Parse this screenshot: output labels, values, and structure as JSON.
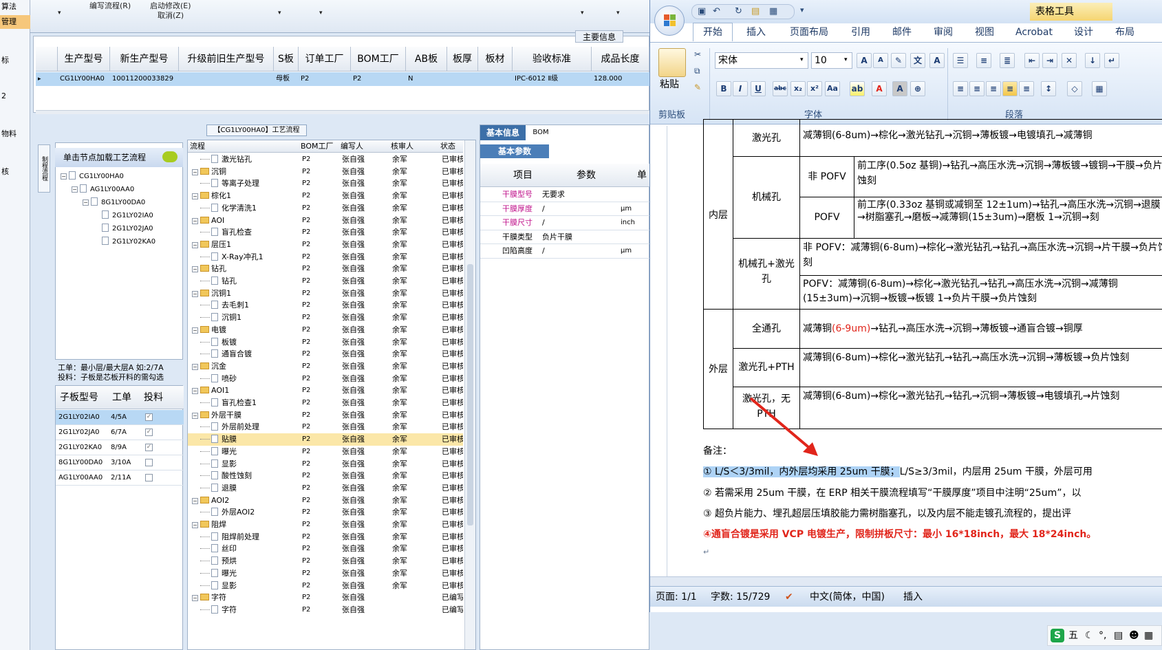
{
  "left_strip": [
    "算法",
    "管理",
    "标",
    "2",
    "物料",
    "核"
  ],
  "top_menu": {
    "item1": "编写流程(R)",
    "item2": "启动修改(E)",
    "item3": "取消(Z)"
  },
  "main_info_label": "主要信息",
  "product_grid": {
    "headers": [
      "生产型号",
      "新生产型号",
      "升级前旧生产型号",
      "S板",
      "订单工厂",
      "BOM工厂",
      "AB板",
      "板厚",
      "板材",
      "验收标准",
      "成品长度"
    ],
    "row": [
      "CG1LY00HA0",
      "10011200033829",
      "",
      "母板",
      "P2",
      "P2",
      "N",
      "",
      "",
      "IPC-6012 Ⅱ级",
      "128.000"
    ]
  },
  "flow_title": "【CG1LY00HA0】工艺流程",
  "side_tab": "制程流程",
  "load_hint": "单击节点加载工艺流程",
  "tree": [
    "CG1LY00HA0",
    "AG1LY00AA0",
    "8G1LY00DA0",
    "2G1LY02IA0",
    "2G1LY02JA0",
    "2G1LY02KA0"
  ],
  "notes": {
    "line1": "工单：最小层/最大层A 如:2/7A",
    "line2": "投料：子板是芯板开料的需勾选"
  },
  "sub_board": {
    "headers": [
      "子板型号",
      "工单",
      "投料"
    ],
    "rows": [
      {
        "model": "2G1LY02IA0",
        "order": "4/5A",
        "checked": true
      },
      {
        "model": "2G1LY02JA0",
        "order": "6/7A",
        "checked": true
      },
      {
        "model": "2G1LY02KA0",
        "order": "8/9A",
        "checked": true
      },
      {
        "model": "8G1LY00DA0",
        "order": "3/10A",
        "checked": false
      },
      {
        "model": "AG1LY00AA0",
        "order": "2/11A",
        "checked": false
      }
    ]
  },
  "flow_grid": {
    "headers": [
      "流程",
      "BOM工厂",
      "编写人",
      "核审人",
      "状态"
    ],
    "rows": [
      {
        "name": "激光钻孔",
        "level": 1,
        "factory": "P2",
        "writer": "张自强",
        "reviewer": "余军",
        "status": "已审核"
      },
      {
        "name": "沉铜",
        "level": 0,
        "factory": "P2",
        "writer": "张自强",
        "reviewer": "余军",
        "status": "已审核"
      },
      {
        "name": "等离子处理",
        "level": 1,
        "factory": "P2",
        "writer": "张自强",
        "reviewer": "余军",
        "status": "已审核"
      },
      {
        "name": "棕化1",
        "level": 0,
        "factory": "P2",
        "writer": "张自强",
        "reviewer": "余军",
        "status": "已审核"
      },
      {
        "name": "化学清洗1",
        "level": 1,
        "factory": "P2",
        "writer": "张自强",
        "reviewer": "余军",
        "status": "已审核"
      },
      {
        "name": "AOI",
        "level": 0,
        "factory": "P2",
        "writer": "张自强",
        "reviewer": "余军",
        "status": "已审核"
      },
      {
        "name": "盲孔检查",
        "level": 1,
        "factory": "P2",
        "writer": "张自强",
        "reviewer": "余军",
        "status": "已审核"
      },
      {
        "name": "层压1",
        "level": 0,
        "factory": "P2",
        "writer": "张自强",
        "reviewer": "余军",
        "status": "已审核"
      },
      {
        "name": "X-Ray冲孔1",
        "level": 1,
        "factory": "P2",
        "writer": "张自强",
        "reviewer": "余军",
        "status": "已审核"
      },
      {
        "name": "钻孔",
        "level": 0,
        "factory": "P2",
        "writer": "张自强",
        "reviewer": "余军",
        "status": "已审核"
      },
      {
        "name": "钻孔",
        "level": 1,
        "factory": "P2",
        "writer": "张自强",
        "reviewer": "余军",
        "status": "已审核"
      },
      {
        "name": "沉铜1",
        "level": 0,
        "factory": "P2",
        "writer": "张自强",
        "reviewer": "余军",
        "status": "已审核"
      },
      {
        "name": "去毛刺1",
        "level": 1,
        "factory": "P2",
        "writer": "张自强",
        "reviewer": "余军",
        "status": "已审核"
      },
      {
        "name": "沉铜1",
        "level": 1,
        "factory": "P2",
        "writer": "张自强",
        "reviewer": "余军",
        "status": "已审核"
      },
      {
        "name": "电镀",
        "level": 0,
        "factory": "P2",
        "writer": "张自强",
        "reviewer": "余军",
        "status": "已审核"
      },
      {
        "name": "板镀",
        "level": 1,
        "factory": "P2",
        "writer": "张自强",
        "reviewer": "余军",
        "status": "已审核"
      },
      {
        "name": "通盲合镀",
        "level": 1,
        "factory": "P2",
        "writer": "张自强",
        "reviewer": "余军",
        "status": "已审核"
      },
      {
        "name": "沉金",
        "level": 0,
        "factory": "P2",
        "writer": "张自强",
        "reviewer": "余军",
        "status": "已审核"
      },
      {
        "name": "喷砂",
        "level": 1,
        "factory": "P2",
        "writer": "张自强",
        "reviewer": "余军",
        "status": "已审核"
      },
      {
        "name": "AOI1",
        "level": 0,
        "factory": "P2",
        "writer": "张自强",
        "reviewer": "余军",
        "status": "已审核"
      },
      {
        "name": "盲孔检查1",
        "level": 1,
        "factory": "P2",
        "writer": "张自强",
        "reviewer": "余军",
        "status": "已审核"
      },
      {
        "name": "外层干膜",
        "level": 0,
        "factory": "P2",
        "writer": "张自强",
        "reviewer": "余军",
        "status": "已审核"
      },
      {
        "name": "外层前处理",
        "level": 1,
        "factory": "P2",
        "writer": "张自强",
        "reviewer": "余军",
        "status": "已审核"
      },
      {
        "name": "贴膜",
        "level": 1,
        "factory": "P2",
        "writer": "张自强",
        "reviewer": "余军",
        "status": "已审核",
        "selected": true
      },
      {
        "name": "曝光",
        "level": 1,
        "factory": "P2",
        "writer": "张自强",
        "reviewer": "余军",
        "status": "已审核"
      },
      {
        "name": "显影",
        "level": 1,
        "factory": "P2",
        "writer": "张自强",
        "reviewer": "余军",
        "status": "已审核"
      },
      {
        "name": "酸性蚀刻",
        "level": 1,
        "factory": "P2",
        "writer": "张自强",
        "reviewer": "余军",
        "status": "已审核"
      },
      {
        "name": "退膜",
        "level": 1,
        "factory": "P2",
        "writer": "张自强",
        "reviewer": "余军",
        "status": "已审核"
      },
      {
        "name": "AOI2",
        "level": 0,
        "factory": "P2",
        "writer": "张自强",
        "reviewer": "余军",
        "status": "已审核"
      },
      {
        "name": "外层AOI2",
        "level": 1,
        "factory": "P2",
        "writer": "张自强",
        "reviewer": "余军",
        "status": "已审核"
      },
      {
        "name": "阻焊",
        "level": 0,
        "factory": "P2",
        "writer": "张自强",
        "reviewer": "余军",
        "status": "已审核"
      },
      {
        "name": "阻焊前处理",
        "level": 1,
        "factory": "P2",
        "writer": "张自强",
        "reviewer": "余军",
        "status": "已审核"
      },
      {
        "name": "丝印",
        "level": 1,
        "factory": "P2",
        "writer": "张自强",
        "reviewer": "余军",
        "status": "已审核"
      },
      {
        "name": "预烘",
        "level": 1,
        "factory": "P2",
        "writer": "张自强",
        "reviewer": "余军",
        "status": "已审核"
      },
      {
        "name": "曝光",
        "level": 1,
        "factory": "P2",
        "writer": "张自强",
        "reviewer": "余军",
        "status": "已审核"
      },
      {
        "name": "显影",
        "level": 1,
        "factory": "P2",
        "writer": "张自强",
        "reviewer": "余军",
        "status": "已审核"
      },
      {
        "name": "字符",
        "level": 0,
        "factory": "P2",
        "writer": "张自强",
        "reviewer": "",
        "status": "已编写"
      },
      {
        "name": "字符",
        "level": 1,
        "factory": "P2",
        "writer": "张自强",
        "reviewer": "",
        "status": "已编写"
      }
    ]
  },
  "info_tabs": [
    "基本信息",
    "BOM"
  ],
  "basic_params_tab": "基本参数",
  "params": {
    "headers": [
      "项目",
      "参数",
      "单"
    ],
    "rows": [
      {
        "item": "干膜型号",
        "value": "无要求",
        "unit": "",
        "highlight": true
      },
      {
        "item": "干膜厚度",
        "value": "/",
        "unit": "μm",
        "highlight": true
      },
      {
        "item": "干膜尺寸",
        "value": "/",
        "unit": "inch",
        "highlight": true
      },
      {
        "item": "干膜类型",
        "value": "负片干膜",
        "unit": "",
        "highlight": false
      },
      {
        "item": "凹陷高度",
        "value": "/",
        "unit": "μm",
        "highlight": false
      }
    ]
  },
  "word": {
    "context_tab": "表格工具",
    "tabs": [
      "开始",
      "插入",
      "页面布局",
      "引用",
      "邮件",
      "审阅",
      "视图",
      "Acrobat",
      "设计",
      "布局"
    ],
    "font_name": "宋体",
    "font_size": "10",
    "groups": {
      "clipboard": "剪贴板",
      "font": "字体",
      "paragraph": "段落"
    },
    "paste_label": "粘贴",
    "table": {
      "inner_label": "内层",
      "outer_label": "外层",
      "laser_hole": "激光孔",
      "laser_text": "减薄铜(6-8um)→棕化→激光钻孔→沉铜→薄板镀→电镀填孔→减薄铜",
      "mech_hole": "机械孔",
      "non_pofv": "非 POFV",
      "non_pofv_text": "前工序(0.5oz 基铜)→钻孔→高压水洗→沉铜→薄板镀→镀铜→干膜→负片蚀刻",
      "pofv": "POFV",
      "pofv_text": "前工序(0.33oz 基铜或减铜至 12±1um)→钻孔→高压水洗→沉铜→退膜→树脂塞孔→磨板→减薄铜(15±3um)→磨板 1→沉铜→刻",
      "mech_laser": "机械孔+激光孔",
      "mech_laser_text1": "非 POFV：减薄铜(6-8um)→棕化→激光钻孔→钻孔→高压水洗→沉铜→片干膜→负片蚀刻",
      "mech_laser_text2": "POFV：减薄铜(6-8um)→棕化→激光钻孔→钻孔→高压水洗→沉铜→减薄铜(15±3um)→沉铜→板镀→板镀 1→负片干膜→负片蚀刻",
      "through_hole": "全通孔",
      "through_text_a": "减薄铜",
      "through_text_red": "(6-9um)",
      "through_text_b": "→钻孔→高压水洗→沉铜→薄板镀→通盲合镀→铜厚",
      "laser_pth": "激光孔+PTH",
      "laser_pth_text": "减薄铜(6-8um)→棕化→激光钻孔→钻孔→高压水洗→沉铜→薄板镀→负片蚀刻",
      "laser_no_pth": "激光孔，无 PTH",
      "laser_no_pth_text": "减薄铜(6-8um)→棕化→激光钻孔→钻孔→沉铜→薄板镀→电镀填孔→片蚀刻"
    },
    "remark": "备注：",
    "note1_sel": "① L/S＜3/3mil，内外层均采用 25um 干膜；",
    "note1_rest": "L/S≥3/3mil，内层用 25um 干膜，外层可用",
    "note2": "② 若需采用 25um 干膜，在 ERP 相关干膜流程填写“干膜厚度”项目中注明“25um”，以",
    "note3": "③ 超负片能力、埋孔超层压填胶能力需树脂塞孔，以及内层不能走镀孔流程的，提出评",
    "note4": "④通盲合镀是采用 VCP 电镀生产，限制拼板尺寸：最小 16*18inch，最大 18*24inch。",
    "status": {
      "page": "页面: 1/1",
      "words": "字数: 15/729",
      "lang": "中文(简体，中国)",
      "insert": "插入"
    }
  },
  "ime": {
    "label": "五"
  },
  "colors": {
    "accent_red": "#e1251b",
    "selection": "#fbe7a8",
    "ribbon": "#dbe7f5"
  }
}
